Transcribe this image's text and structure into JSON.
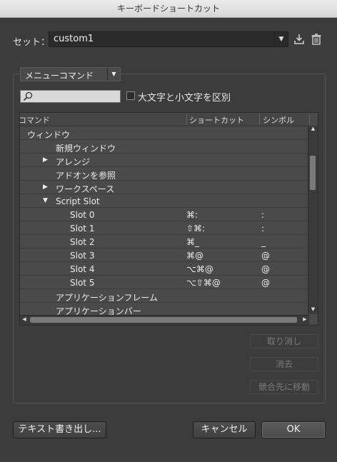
{
  "window": {
    "title": "キーボードショートカット"
  },
  "set": {
    "label": "セット：",
    "value": "custom1"
  },
  "commands": {
    "type_value": "メニューコマンド",
    "search_placeholder": "",
    "case_checkbox_label": "大文字と小文字を区別",
    "case_checked": false
  },
  "table": {
    "columns": [
      "コマンド",
      "ショートカット",
      "シンボル"
    ],
    "rows": [
      {
        "indent": 0,
        "toggle": "",
        "label": "ウィンドウ",
        "shortcut": "",
        "symbol": ""
      },
      {
        "indent": 1,
        "toggle": "",
        "label": "新規ウィンドウ",
        "shortcut": "",
        "symbol": ""
      },
      {
        "indent": 1,
        "toggle": "▶",
        "label": "アレンジ",
        "shortcut": "",
        "symbol": ""
      },
      {
        "indent": 1,
        "toggle": "",
        "label": "アドオンを参照",
        "shortcut": "",
        "symbol": ""
      },
      {
        "indent": 1,
        "toggle": "▶",
        "label": "ワークスペース",
        "shortcut": "",
        "symbol": ""
      },
      {
        "indent": 1,
        "toggle": "▼",
        "label": "Script Slot",
        "shortcut": "",
        "symbol": ""
      },
      {
        "indent": 2,
        "toggle": "",
        "label": "Slot 0",
        "shortcut": "⌘:",
        "symbol": ":"
      },
      {
        "indent": 2,
        "toggle": "",
        "label": "Slot 1",
        "shortcut": "⇧⌘:",
        "symbol": ":"
      },
      {
        "indent": 2,
        "toggle": "",
        "label": "Slot 2",
        "shortcut": "⌘_",
        "symbol": "_"
      },
      {
        "indent": 2,
        "toggle": "",
        "label": "Slot 3",
        "shortcut": "⌘@",
        "symbol": "@"
      },
      {
        "indent": 2,
        "toggle": "",
        "label": "Slot 4",
        "shortcut": "⌥⌘@",
        "symbol": "@"
      },
      {
        "indent": 2,
        "toggle": "",
        "label": "Slot 5",
        "shortcut": "⌥⇧⌘@",
        "symbol": "@"
      },
      {
        "indent": 1,
        "toggle": "",
        "label": "アプリケーションフレーム",
        "shortcut": "",
        "symbol": ""
      },
      {
        "indent": 1,
        "toggle": "",
        "label": "アプリケーションバー",
        "shortcut": "",
        "symbol": ""
      }
    ]
  },
  "side_buttons": {
    "undo": "取り消し",
    "clear": "消去",
    "goto_conflict": "競合先に移動"
  },
  "footer": {
    "export": "テキスト書き出し...",
    "cancel": "キャンセル",
    "ok": "OK"
  },
  "icons": {
    "save": "save-icon",
    "delete": "trash-icon",
    "search": "magnifier-icon"
  }
}
